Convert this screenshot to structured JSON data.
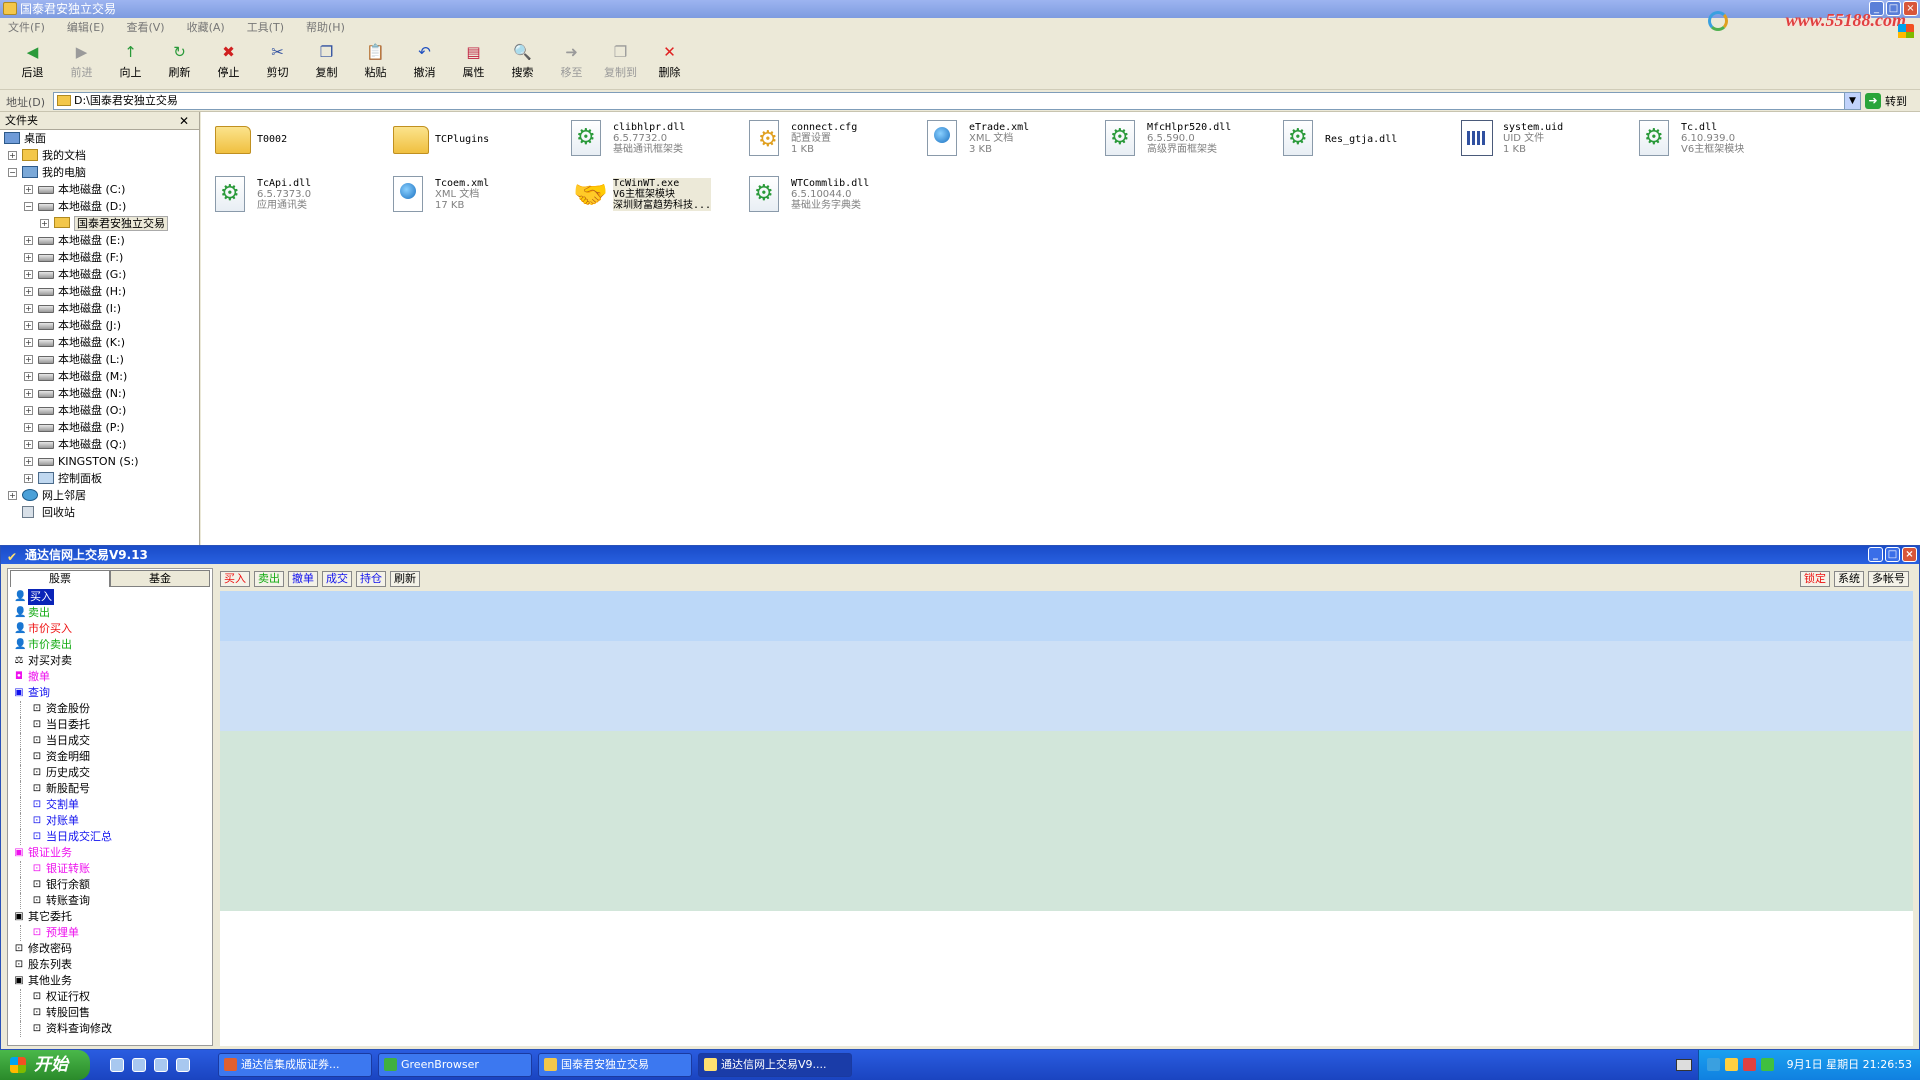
{
  "explorer": {
    "title": "国泰君安独立交易",
    "menu": [
      "文件(F)",
      "编辑(E)",
      "查看(V)",
      "收藏(A)",
      "工具(T)",
      "帮助(H)"
    ],
    "brand": "www.55188.com",
    "toolbar": [
      {
        "label": "后退",
        "icon": "back-icon",
        "color": "#2a9a3a",
        "glyph": "◀"
      },
      {
        "label": "前进",
        "icon": "forward-icon",
        "color": "#9a9a9a",
        "glyph": "▶",
        "disabled": true
      },
      {
        "label": "向上",
        "icon": "up-folder-icon",
        "color": "#2a9a3a",
        "glyph": "↑"
      },
      {
        "label": "刷新",
        "icon": "refresh-icon",
        "color": "#2a9a3a",
        "glyph": "↻"
      },
      {
        "label": "停止",
        "icon": "stop-icon",
        "color": "#d02020",
        "glyph": "✖"
      },
      {
        "label": "剪切",
        "icon": "cut-icon",
        "color": "#3050a0",
        "glyph": "✂"
      },
      {
        "label": "复制",
        "icon": "copy-icon",
        "color": "#3050a0",
        "glyph": "❐"
      },
      {
        "label": "粘贴",
        "icon": "paste-icon",
        "color": "#3050a0",
        "glyph": "📋"
      },
      {
        "label": "撤消",
        "icon": "undo-icon",
        "color": "#2050c0",
        "glyph": "↶"
      },
      {
        "label": "属性",
        "icon": "properties-icon",
        "color": "#c02040",
        "glyph": "▤"
      },
      {
        "label": "搜索",
        "icon": "search-icon",
        "color": "#3050a0",
        "glyph": "🔍"
      },
      {
        "label": "移至",
        "icon": "move-to-icon",
        "color": "#9a9a9a",
        "glyph": "➜",
        "disabled": true
      },
      {
        "label": "复制到",
        "icon": "copy-to-icon",
        "color": "#9a9a9a",
        "glyph": "❐",
        "disabled": true
      },
      {
        "label": "删除",
        "icon": "delete-icon",
        "color": "#e02020",
        "glyph": "✕"
      }
    ],
    "address_label": "地址(D)",
    "address_value": "D:\\国泰君安独立交易",
    "go_label": "转到",
    "folders_title": "文件夹",
    "tree": [
      {
        "label": "桌面",
        "icon": "desk",
        "level": 0,
        "pm": ""
      },
      {
        "label": "我的文档",
        "icon": "docs",
        "level": 1,
        "pm": "+"
      },
      {
        "label": "我的电脑",
        "icon": "pc",
        "level": 1,
        "pm": "−"
      },
      {
        "label": "本地磁盘 (C:)",
        "icon": "drive",
        "level": 2,
        "pm": "+"
      },
      {
        "label": "本地磁盘 (D:)",
        "icon": "drive",
        "level": 2,
        "pm": "−"
      },
      {
        "label": "国泰君安独立交易",
        "icon": "folder",
        "level": 3,
        "pm": "+",
        "selected": true
      },
      {
        "label": "本地磁盘 (E:)",
        "icon": "drive",
        "level": 2,
        "pm": "+"
      },
      {
        "label": "本地磁盘 (F:)",
        "icon": "drive",
        "level": 2,
        "pm": "+"
      },
      {
        "label": "本地磁盘 (G:)",
        "icon": "drive",
        "level": 2,
        "pm": "+"
      },
      {
        "label": "本地磁盘 (H:)",
        "icon": "drive",
        "level": 2,
        "pm": "+"
      },
      {
        "label": "本地磁盘 (I:)",
        "icon": "drive",
        "level": 2,
        "pm": "+"
      },
      {
        "label": "本地磁盘 (J:)",
        "icon": "drive",
        "level": 2,
        "pm": "+"
      },
      {
        "label": "本地磁盘 (K:)",
        "icon": "drive",
        "level": 2,
        "pm": "+"
      },
      {
        "label": "本地磁盘 (L:)",
        "icon": "drive",
        "level": 2,
        "pm": "+"
      },
      {
        "label": "本地磁盘 (M:)",
        "icon": "drive",
        "level": 2,
        "pm": "+"
      },
      {
        "label": "本地磁盘 (N:)",
        "icon": "drive",
        "level": 2,
        "pm": "+"
      },
      {
        "label": "本地磁盘 (O:)",
        "icon": "drive",
        "level": 2,
        "pm": "+"
      },
      {
        "label": "本地磁盘 (P:)",
        "icon": "drive",
        "level": 2,
        "pm": "+"
      },
      {
        "label": "本地磁盘 (Q:)",
        "icon": "drive",
        "level": 2,
        "pm": "+"
      },
      {
        "label": "KINGSTON (S:)",
        "icon": "drive",
        "level": 2,
        "pm": "+"
      },
      {
        "label": "控制面板",
        "icon": "cp",
        "level": 2,
        "pm": "+"
      },
      {
        "label": "网上邻居",
        "icon": "net",
        "level": 1,
        "pm": "+"
      },
      {
        "label": "回收站",
        "icon": "bin",
        "level": 1,
        "pm": ""
      }
    ],
    "files": [
      {
        "name": "T0002",
        "type": "folder-ico",
        "lines": []
      },
      {
        "name": "TCPlugins",
        "type": "folder-ico",
        "lines": []
      },
      {
        "name": "clibhlpr.dll",
        "type": "dll-ico",
        "lines": [
          "6.5.7732.0",
          "基础通讯框架类"
        ]
      },
      {
        "name": "connect.cfg",
        "type": "cfg-ico",
        "lines": [
          "配置设置",
          "1 KB"
        ]
      },
      {
        "name": "eTrade.xml",
        "type": "xml-ico",
        "lines": [
          "XML 文档",
          "3 KB"
        ]
      },
      {
        "name": "MfcHlpr520.dll",
        "type": "dll-ico",
        "lines": [
          "6.5.590.0",
          "高级界面框架类"
        ]
      },
      {
        "name": "Res_gtja.dll",
        "type": "dll-ico",
        "lines": []
      },
      {
        "name": "system.uid",
        "type": "uid-ico",
        "lines": [
          "UID 文件",
          "1 KB"
        ]
      },
      {
        "name": "Tc.dll",
        "type": "dll-ico",
        "lines": [
          "6.10.939.0",
          "V6主框架模块"
        ]
      },
      {
        "name": "TcApi.dll",
        "type": "dll-ico",
        "lines": [
          "6.5.7373.0",
          "应用通讯类"
        ]
      },
      {
        "name": "Tcoem.xml",
        "type": "xml-ico",
        "lines": [
          "XML 文档",
          "17 KB"
        ]
      },
      {
        "name": "TcWinWT.exe",
        "type": "exe-ico",
        "lines": [
          "V6主框架模块",
          "深圳财富趋势科技..."
        ],
        "highlight": true
      },
      {
        "name": "WTCommlib.dll",
        "type": "dll-ico",
        "lines": [
          "6.5.10044.0",
          "基础业务字典类"
        ]
      }
    ]
  },
  "trade": {
    "title": "通达信网上交易V9.13",
    "tabs": [
      "股票",
      "基金"
    ],
    "menu": [
      {
        "label": "买入",
        "color": "c-red",
        "level": 0,
        "icon": "👤",
        "selected": true
      },
      {
        "label": "卖出",
        "color": "c-green",
        "level": 0,
        "icon": "👤"
      },
      {
        "label": "市价买入",
        "color": "c-red",
        "level": 0,
        "icon": "👤"
      },
      {
        "label": "市价卖出",
        "color": "c-green",
        "level": 0,
        "icon": "👤"
      },
      {
        "label": "对买对卖",
        "color": "c-black",
        "level": 0,
        "icon": "⚖"
      },
      {
        "label": "撤单",
        "color": "c-mag",
        "level": 0,
        "icon": "◘"
      },
      {
        "label": "查询",
        "color": "c-blue",
        "level": 0,
        "icon": "▣"
      },
      {
        "label": "资金股份",
        "color": "c-black",
        "level": 1,
        "icon": "⊡"
      },
      {
        "label": "当日委托",
        "color": "c-black",
        "level": 1,
        "icon": "⊡"
      },
      {
        "label": "当日成交",
        "color": "c-black",
        "level": 1,
        "icon": "⊡"
      },
      {
        "label": "资金明细",
        "color": "c-black",
        "level": 1,
        "icon": "⊡"
      },
      {
        "label": "历史成交",
        "color": "c-black",
        "level": 1,
        "icon": "⊡"
      },
      {
        "label": "新股配号",
        "color": "c-black",
        "level": 1,
        "icon": "⊡"
      },
      {
        "label": "交割单",
        "color": "c-blue",
        "level": 1,
        "icon": "⊡"
      },
      {
        "label": "对账单",
        "color": "c-blue",
        "level": 1,
        "icon": "⊡"
      },
      {
        "label": "当日成交汇总",
        "color": "c-blue",
        "level": 1,
        "icon": "⊡"
      },
      {
        "label": "银证业务",
        "color": "c-mag",
        "level": 0,
        "icon": "▣"
      },
      {
        "label": "银证转账",
        "color": "c-mag",
        "level": 1,
        "icon": "⊡"
      },
      {
        "label": "银行余额",
        "color": "c-black",
        "level": 1,
        "icon": "⊡"
      },
      {
        "label": "转账查询",
        "color": "c-black",
        "level": 1,
        "icon": "⊡"
      },
      {
        "label": "其它委托",
        "color": "c-black",
        "level": 0,
        "icon": "▣"
      },
      {
        "label": "预埋单",
        "color": "c-mag",
        "level": 1,
        "icon": "⊡"
      },
      {
        "label": "修改密码",
        "color": "c-black",
        "level": 0,
        "icon": "⊡"
      },
      {
        "label": "股东列表",
        "color": "c-black",
        "level": 0,
        "icon": "⊡"
      },
      {
        "label": "其他业务",
        "color": "c-black",
        "level": 0,
        "icon": "▣"
      },
      {
        "label": "权证行权",
        "color": "c-black",
        "level": 1,
        "icon": "⊡"
      },
      {
        "label": "转股回售",
        "color": "c-black",
        "level": 1,
        "icon": "⊡"
      },
      {
        "label": "资料查询修改",
        "color": "c-black",
        "level": 1,
        "icon": "⊡"
      }
    ],
    "buttons_left": [
      {
        "label": "买入",
        "cls": "r"
      },
      {
        "label": "卖出",
        "cls": "g"
      },
      {
        "label": "撤单",
        "cls": "b"
      },
      {
        "label": "成交",
        "cls": "b"
      },
      {
        "label": "持仓",
        "cls": "b"
      },
      {
        "label": "刷新",
        "cls": ""
      }
    ],
    "buttons_right": [
      {
        "label": "锁定",
        "cls": "r"
      },
      {
        "label": "系统",
        "cls": ""
      },
      {
        "label": "多帐号",
        "cls": ""
      }
    ]
  },
  "taskbar": {
    "start": "开始",
    "tasks": [
      {
        "label": "通达信集成版证券...",
        "color": "#e06030"
      },
      {
        "label": "GreenBrowser",
        "color": "#40b040"
      },
      {
        "label": "国泰君安独立交易",
        "color": "#f3c74a"
      },
      {
        "label": "通达信网上交易V9....",
        "color": "#ffe070",
        "active": true
      }
    ],
    "clock": "9月1日 星期日 21:26:53"
  }
}
